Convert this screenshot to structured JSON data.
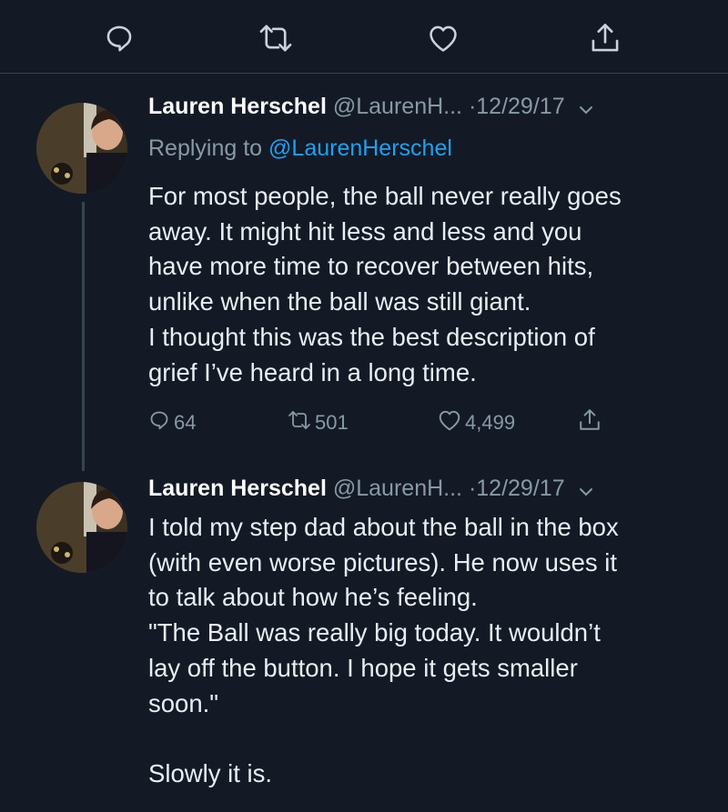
{
  "top_actions": {
    "reply_icon": "reply-icon",
    "retweet_icon": "retweet-icon",
    "like_icon": "heart-icon",
    "share_icon": "share-icon"
  },
  "tweets": [
    {
      "name": "Lauren Herschel",
      "handle": "@LaurenH...",
      "date": "·12/29/17",
      "replying_prefix": "Replying to",
      "replying_handle": "@LaurenHerschel",
      "text": "For most people, the ball never really goes\naway. It might hit less and less and you\nhave more time to recover between hits,\nunlike when the ball was still giant.\nI thought this was the best description of\ngrief I’ve heard in a long time.",
      "replies": "64",
      "retweets": "501",
      "likes": "4,499"
    },
    {
      "name": "Lauren Herschel",
      "handle": "@LaurenH...",
      "date": "·12/29/17",
      "text": "I told my step dad about the ball in the box\n(with even worse pictures). He now uses it\nto talk about how he’s feeling.\n\"The Ball was really big today. It wouldn’t\nlay off the button. I hope it gets smaller\nsoon.\"\n\nSlowly it is."
    }
  ],
  "colors": {
    "background": "#131a26",
    "muted": "#8899a6",
    "link": "#1da1f2",
    "divider": "#38444d"
  }
}
